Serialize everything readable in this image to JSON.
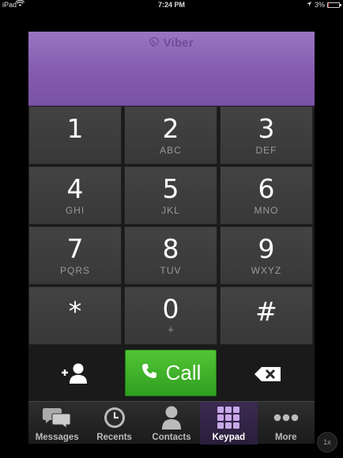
{
  "status_bar": {
    "carrier": "iPad",
    "time": "7:24 PM",
    "battery": "3%",
    "battery_level": 0.03
  },
  "header": {
    "logo_text": "Viber"
  },
  "keypad": {
    "keys": [
      {
        "digit": "1",
        "letters": ""
      },
      {
        "digit": "2",
        "letters": "ABC"
      },
      {
        "digit": "3",
        "letters": "DEF"
      },
      {
        "digit": "4",
        "letters": "GHI"
      },
      {
        "digit": "5",
        "letters": "JKL"
      },
      {
        "digit": "6",
        "letters": "MNO"
      },
      {
        "digit": "7",
        "letters": "PQRS"
      },
      {
        "digit": "8",
        "letters": "TUV"
      },
      {
        "digit": "9",
        "letters": "WXYZ"
      },
      {
        "digit": "*",
        "letters": ""
      },
      {
        "digit": "0",
        "letters": "+"
      },
      {
        "digit": "#",
        "letters": ""
      }
    ],
    "call_label": "Call"
  },
  "tabs": [
    {
      "label": "Messages",
      "icon": "messages-icon",
      "active": false
    },
    {
      "label": "Recents",
      "icon": "clock-icon",
      "active": false
    },
    {
      "label": "Contacts",
      "icon": "contact-icon",
      "active": false
    },
    {
      "label": "Keypad",
      "icon": "keypad-icon",
      "active": true
    },
    {
      "label": "More",
      "icon": "more-icon",
      "active": false
    }
  ],
  "zoom_label": "1x",
  "colors": {
    "brand": "#8259ae",
    "call": "#3fb22a"
  }
}
